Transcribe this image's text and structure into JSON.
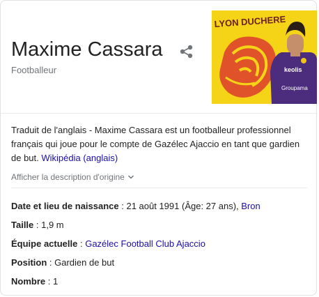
{
  "entity": {
    "name": "Maxime Cassara",
    "subtitle": "Footballeur"
  },
  "photo": {
    "banner_text": "LYON DUCHERE",
    "jersey_sponsor_1": "keolis",
    "jersey_sponsor_2": "Groupama",
    "colors": {
      "banner": "#f5d417",
      "lion": "#e0522a",
      "jersey": "#4b2c7d",
      "sky": "#d6d2c8"
    }
  },
  "description": {
    "text": "Traduit de l'anglais - Maxime Cassara est un footballeur professionnel français qui joue pour le compte de Gazélec Ajaccio en tant que gardien de but. ",
    "source_link": "Wikipédia (anglais)",
    "show_original": "Afficher la description d'origine"
  },
  "facts": [
    {
      "label": "Date et lieu de naissance",
      "sep": " : ",
      "value": "21 août 1991 (Âge: 27 ans), ",
      "link": "Bron"
    },
    {
      "label": "Taille",
      "sep": " : ",
      "value": "1,9 m",
      "link": ""
    },
    {
      "label": "Équipe actuelle",
      "sep": " : ",
      "value": "",
      "link": "Gazélec Football Club Ajaccio"
    },
    {
      "label": "Position",
      "sep": " : ",
      "value": "Gardien de but",
      "link": ""
    },
    {
      "label": "Nombre",
      "sep": " : ",
      "value": "1",
      "link": ""
    }
  ],
  "colors": {
    "link": "#1a0dab",
    "muted": "#70757a",
    "text": "#222222",
    "border": "#dfe1e5"
  },
  "icons": {
    "share": "share-icon",
    "chevron": "chevron-down-icon"
  }
}
